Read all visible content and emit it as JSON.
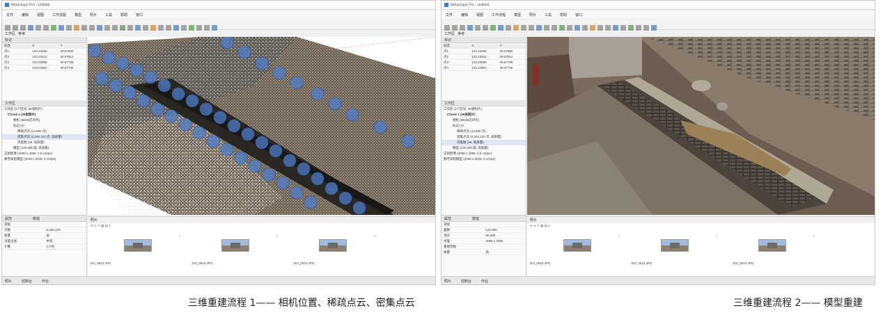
{
  "left": {
    "title": "Metashape Pro - Untitled",
    "menu": [
      "文件",
      "编辑",
      "视图",
      "工作流程",
      "模型",
      "照片",
      "工具",
      "帮助",
      "窗口"
    ],
    "tab_labels": [
      "工作区",
      "参考"
    ],
    "markers_header": "标记",
    "marker_columns": [
      "标签",
      "X",
      "Y"
    ],
    "marker_rows": [
      [
        "点1",
        "104.23456",
        "30.67890"
      ],
      [
        "点2",
        "104.23512",
        "30.67812"
      ],
      [
        "点3",
        "104.23588",
        "30.67798"
      ],
      [
        "点4",
        "104.23601",
        "30.67745"
      ]
    ],
    "workspace_header": "工作区",
    "tree_items": [
      "工作区 (1个区块, 36张照片)",
      "Chunk 1 (36张照片)",
      "相机 (36/36已对齐)",
      "标记 (4)",
      "稀疏点云 (12,580 点)",
      "密集点云 (2,345,120 点, 高质量)",
      "深度图 (36, 高质量)",
      "模型 (120,000 面, 高质量)",
      "正射影像 (4096 x 4096, 2.5 cm/px)",
      "数字高程模型 (2048 x 2048, 5 cm/px)"
    ],
    "props_header": "属性",
    "props_col2": "数值",
    "props_rows": [
      [
        "常规",
        ""
      ],
      [
        "点数",
        "2,345,120"
      ],
      [
        "质量",
        "高"
      ],
      [
        "深度过滤",
        "中等"
      ],
      [
        "计算",
        "1小时"
      ]
    ],
    "photos_header": "照片",
    "photo_names": [
      "DJI_0012.JPG",
      "DJI_0013.JPG",
      "DJI_0014.JPG"
    ],
    "status_tabs": [
      "照片",
      "控制台",
      "作业"
    ]
  },
  "right": {
    "title": "Metashape Pro - Untitled",
    "menu": [
      "文件",
      "编辑",
      "视图",
      "工作流程",
      "模型",
      "照片",
      "工具",
      "帮助",
      "窗口"
    ],
    "tab_labels": [
      "工作区",
      "参考"
    ],
    "markers_header": "标记",
    "marker_columns": [
      "标签",
      "X",
      "Y"
    ],
    "marker_rows": [
      [
        "点1",
        "104.23456",
        "30.67890"
      ],
      [
        "点2",
        "104.23512",
        "30.67812"
      ],
      [
        "点3",
        "104.23588",
        "30.67798"
      ],
      [
        "点4",
        "104.23601",
        "30.67745"
      ]
    ],
    "workspace_header": "工作区",
    "tree_items": [
      "工作区 (1个区块, 36张照片)",
      "Chunk 1 (36张照片)",
      "相机 (36/36已对齐)",
      "标记 (4)",
      "稀疏点云 (12,580 点)",
      "密集点云 (2,345,120 点, 高质量)",
      "深度图 (36, 高质量)",
      "模型 (120,000 面, 高质量)",
      "正射影像 (4096 x 4096, 2.5 cm/px)",
      "数字高程模型 (2048 x 2048, 5 cm/px)"
    ],
    "props_header": "属性",
    "props_col2": "数值",
    "props_rows": [
      [
        "常规",
        ""
      ],
      [
        "面数",
        "120,000"
      ],
      [
        "顶点",
        "60,250"
      ],
      [
        "纹理",
        "4096 x 4096"
      ],
      [
        "重建参数",
        ""
      ],
      [
        "质量",
        "高"
      ]
    ],
    "photos_header": "照片",
    "photo_names": [
      "DJI_0012.JPG",
      "DJI_0013.JPG",
      "DJI_0014.JPG"
    ],
    "status_tabs": [
      "照片",
      "控制台",
      "作业"
    ]
  },
  "captions": {
    "left": "三维重建流程 1—— 相机位置、稀疏点云、密集点云",
    "right": "三维重建流程 2—— 模型重建"
  },
  "colors": {
    "camera_marker": "#4f7ec9",
    "selection": "#dde7f5"
  }
}
